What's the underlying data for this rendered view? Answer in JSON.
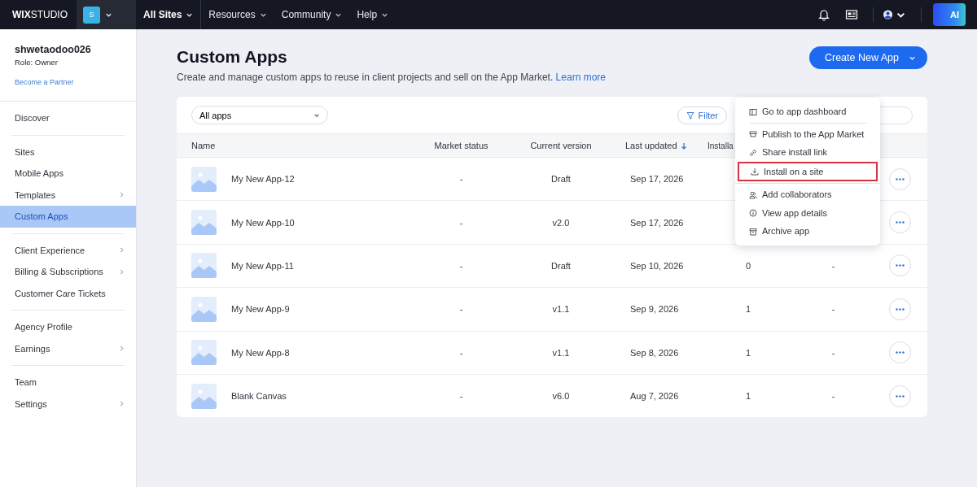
{
  "top_bar": {
    "logo": "**WIX**STUDIO",
    "site_badge": "S",
    "nav": [
      {
        "label": "All Sites",
        "selected": true
      },
      {
        "label": "Resources",
        "selected": false
      },
      {
        "label": "Community",
        "selected": false
      },
      {
        "label": "Help",
        "selected": false
      }
    ],
    "ai_button": "AI"
  },
  "sidebar": {
    "account": {
      "name": "shwetaodoo026",
      "role": "Role: Owner",
      "link": "Become a Partner"
    },
    "sections": [
      [
        {
          "label": "Discover",
          "selected": false,
          "expandable": false
        }
      ],
      [
        {
          "label": "Sites",
          "selected": false,
          "expandable": false
        },
        {
          "label": "Mobile Apps",
          "selected": false,
          "expandable": false
        },
        {
          "label": "Templates",
          "selected": false,
          "expandable": true
        },
        {
          "label": "Custom Apps",
          "selected": true,
          "expandable": false
        }
      ],
      [
        {
          "label": "Client Experience",
          "selected": false,
          "expandable": true
        },
        {
          "label": "Billing & Subscriptions",
          "selected": false,
          "expandable": true
        },
        {
          "label": "Customer Care Tickets",
          "selected": false,
          "expandable": false
        }
      ],
      [
        {
          "label": "Agency Profile",
          "selected": false,
          "expandable": false
        },
        {
          "label": "Earnings",
          "selected": false,
          "expandable": true
        }
      ],
      [
        {
          "label": "Team",
          "selected": false,
          "expandable": false
        },
        {
          "label": "Settings",
          "selected": false,
          "expandable": true
        }
      ]
    ]
  },
  "page": {
    "title": "Custom Apps",
    "subtitle": "Create and manage custom apps to reuse in client projects and sell on the App Market.",
    "subtitle_link": "Learn more",
    "primary_button": "Create New App"
  },
  "table": {
    "filter_dropdown": "All apps",
    "filter_button": "Filter",
    "columns": [
      {
        "label": "Name",
        "sorted": false
      },
      {
        "label": "Market status",
        "sorted": false
      },
      {
        "label": "Current version",
        "sorted": false
      },
      {
        "label": "Last updated",
        "sorted": true
      },
      {
        "label": "Installa",
        "sorted": false
      }
    ],
    "rows": [
      {
        "name": "My New App-12",
        "market_status": "-",
        "version": "Draft",
        "last_updated": "Sep 17, 2026"
      },
      {
        "name": "My New App-10",
        "market_status": "-",
        "version": "v2.0",
        "last_updated": "Sep 17, 2026"
      },
      {
        "name": "My New App-11",
        "market_status": "-",
        "version": "Draft",
        "last_updated": "Sep 10, 2026",
        "installs": "0",
        "column_6": "-"
      },
      {
        "name": "My New App-9",
        "market_status": "-",
        "version": "v1.1",
        "last_updated": "Sep 9, 2026",
        "installs": "1",
        "column_6": "-"
      },
      {
        "name": "My New App-8",
        "market_status": "-",
        "version": "v1.1",
        "last_updated": "Sep 8, 2026",
        "installs": "1",
        "column_6": "-"
      },
      {
        "name": "Blank Canvas",
        "market_status": "-",
        "version": "v6.0",
        "last_updated": "Aug 7, 2026",
        "installs": "1",
        "column_6": "-"
      }
    ]
  },
  "context_menu": {
    "groups": [
      [
        {
          "kind": "dashboard",
          "label": "Go to app dashboard",
          "highlighted": false
        }
      ],
      [
        {
          "kind": "store",
          "label": "Publish to the App Market",
          "highlighted": false
        },
        {
          "kind": "link",
          "label": "Share install link",
          "highlighted": false
        },
        {
          "kind": "download",
          "label": "Install on a site",
          "highlighted": true
        }
      ],
      [
        {
          "kind": "people",
          "label": "Add collaborators",
          "highlighted": false
        },
        {
          "kind": "info",
          "label": "View app details",
          "highlighted": false
        },
        {
          "kind": "archive",
          "label": "Archive app",
          "highlighted": false
        }
      ]
    ]
  }
}
